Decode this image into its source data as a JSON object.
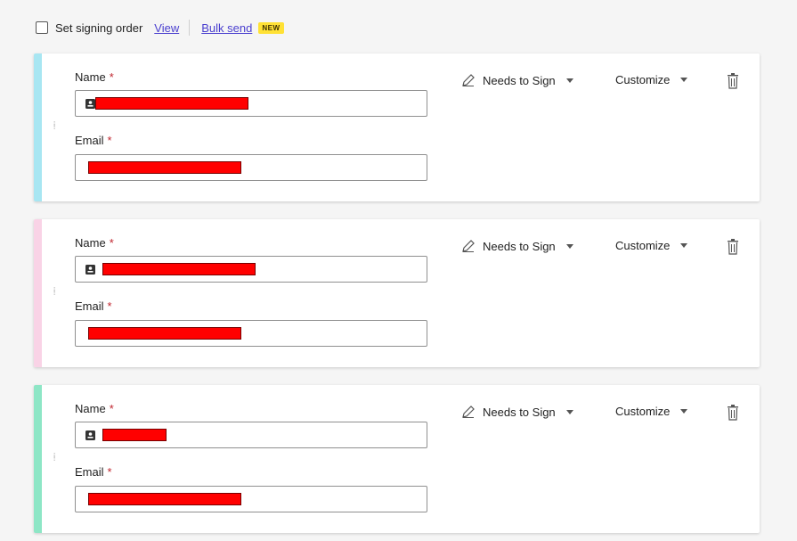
{
  "topbar": {
    "signing_order_label": "Set signing order",
    "view_link": "View",
    "bulk_send_link": "Bulk send",
    "new_badge": "NEW"
  },
  "recipients": [
    {
      "stripe_color": "#a8e6f2",
      "name_label": "Name",
      "email_label": "Email",
      "required_marker": "*",
      "role": "Needs to Sign",
      "customize": "Customize"
    },
    {
      "stripe_color": "#f9d3e6",
      "name_label": "Name",
      "email_label": "Email",
      "required_marker": "*",
      "role": "Needs to Sign",
      "customize": "Customize"
    },
    {
      "stripe_color": "#8ee6c6",
      "name_label": "Name",
      "email_label": "Email",
      "required_marker": "*",
      "role": "Needs to Sign",
      "customize": "Customize"
    }
  ],
  "icons": {
    "contact": "contact-card-icon",
    "pen": "pen-icon",
    "trash": "trash-icon",
    "drag": "drag-handle-icon"
  }
}
